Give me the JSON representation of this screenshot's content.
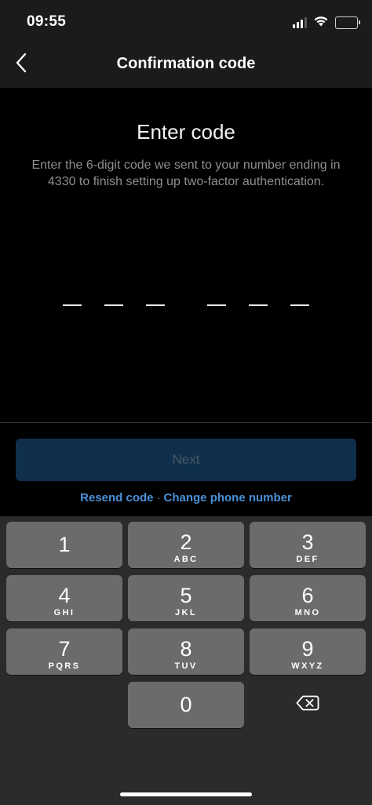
{
  "status_bar": {
    "time": "09:55",
    "icons": [
      "signal-icon",
      "wifi-icon",
      "battery-icon"
    ]
  },
  "header": {
    "title": "Confirmation code",
    "back_icon": "chevron-left-icon"
  },
  "content": {
    "title": "Enter code",
    "description": "Enter the 6-digit code we sent to your number ending in 4330 to finish setting up two-factor authentication.",
    "code_length": 6,
    "code_value": ""
  },
  "actions": {
    "next_label": "Next",
    "resend_label": "Resend code",
    "separator": "·",
    "change_phone_label": "Change phone number"
  },
  "keyboard": {
    "keys": [
      {
        "digit": "1",
        "letters": ""
      },
      {
        "digit": "2",
        "letters": "ABC"
      },
      {
        "digit": "3",
        "letters": "DEF"
      },
      {
        "digit": "4",
        "letters": "GHI"
      },
      {
        "digit": "5",
        "letters": "JKL"
      },
      {
        "digit": "6",
        "letters": "MNO"
      },
      {
        "digit": "7",
        "letters": "PQRS"
      },
      {
        "digit": "8",
        "letters": "TUV"
      },
      {
        "digit": "9",
        "letters": "WXYZ"
      },
      {
        "digit": "0",
        "letters": ""
      }
    ],
    "delete_icon": "backspace-icon"
  },
  "colors": {
    "accent_link": "#4a90d9",
    "next_button_disabled": "#0f2f4c",
    "key_background": "#6b6b6b",
    "keyboard_background": "#2b2b2b"
  }
}
